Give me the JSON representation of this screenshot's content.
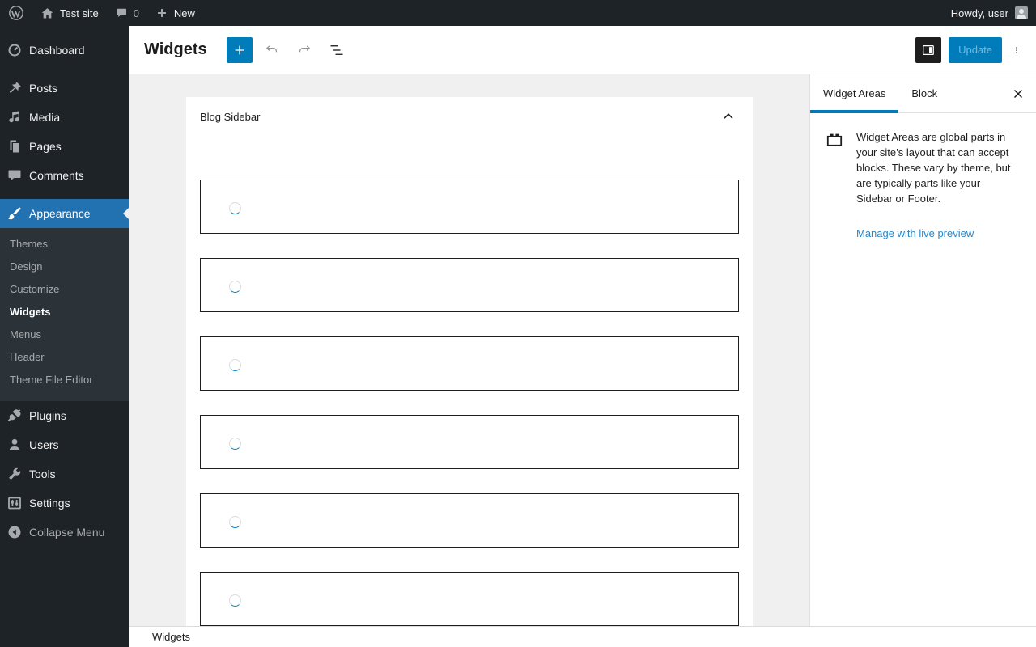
{
  "admin_bar": {
    "site_name": "Test site",
    "comment_count": "0",
    "new_label": "New",
    "greeting": "Howdy, user"
  },
  "sidebar": {
    "items": [
      {
        "label": "Dashboard",
        "icon": "dashboard-icon"
      },
      {
        "label": "Posts",
        "icon": "pin-icon"
      },
      {
        "label": "Media",
        "icon": "media-icon"
      },
      {
        "label": "Pages",
        "icon": "pages-icon"
      },
      {
        "label": "Comments",
        "icon": "comment-icon"
      },
      {
        "label": "Appearance",
        "icon": "brush-icon"
      },
      {
        "label": "Plugins",
        "icon": "plugin-icon"
      },
      {
        "label": "Users",
        "icon": "user-icon"
      },
      {
        "label": "Tools",
        "icon": "wrench-icon"
      },
      {
        "label": "Settings",
        "icon": "settings-icon"
      },
      {
        "label": "Collapse Menu",
        "icon": "collapse-icon"
      }
    ],
    "active_item": "Appearance",
    "appearance_submenu": [
      "Themes",
      "Design",
      "Customize",
      "Widgets",
      "Menus",
      "Header",
      "Theme File Editor"
    ],
    "active_subitem": "Widgets"
  },
  "editor": {
    "title": "Widgets",
    "update_label": "Update"
  },
  "canvas": {
    "widget_area_title": "Blog Sidebar",
    "loading_block_count": 6
  },
  "inspector": {
    "tabs": [
      {
        "label": "Widget Areas"
      },
      {
        "label": "Block"
      }
    ],
    "active_tab": "Widget Areas",
    "description": "Widget Areas are global parts in your site’s layout that can accept blocks. These vary by theme, but are typically parts like your Sidebar or Footer.",
    "manage_link": "Manage with live preview"
  },
  "footer": {
    "breadcrumb": "Widgets"
  },
  "colors": {
    "admin_accent": "#2271b1",
    "editor_accent": "#007cba",
    "link_blue": "#2b87c8",
    "dark_bg": "#1d2327",
    "submenu_bg": "#2c3338",
    "canvas_bg": "#f0f0f0"
  }
}
